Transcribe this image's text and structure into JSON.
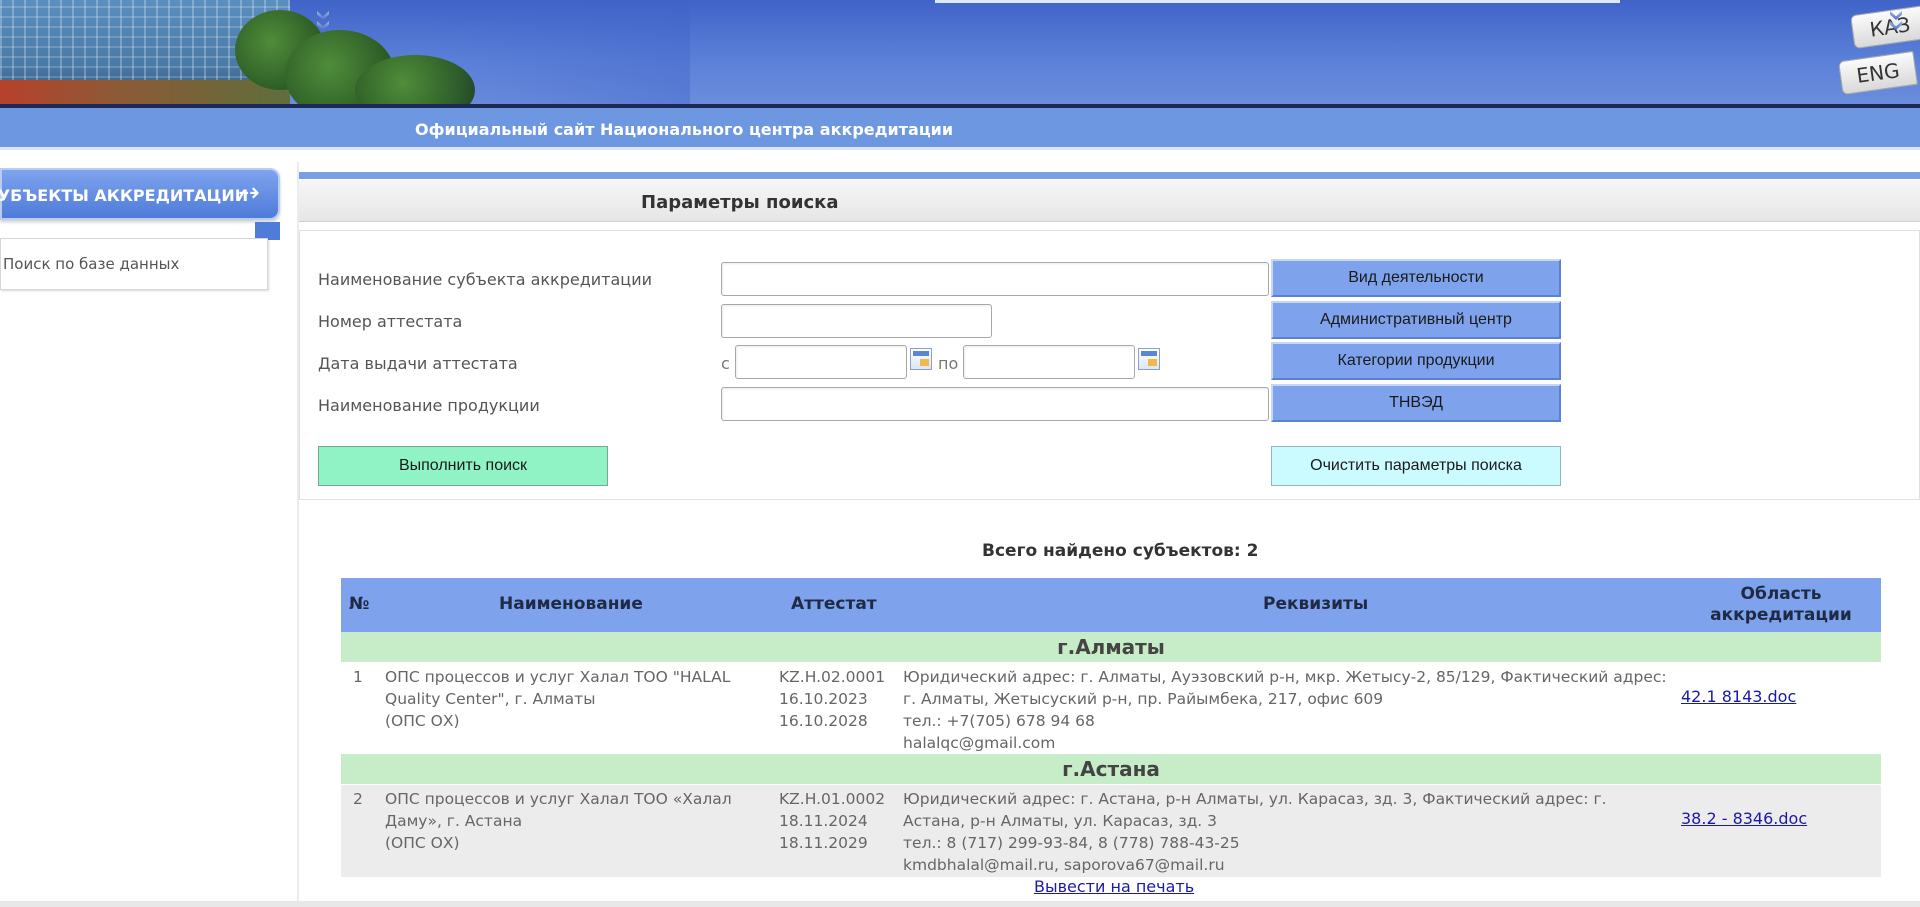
{
  "header": {
    "lang_kaz": "КАЗ",
    "lang_eng": "ENG",
    "site_title": "Официальный сайт Национального центра аккредитации"
  },
  "sidebar": {
    "section_title": "СУБЪЕКТЫ АККРЕДИТАЦИИ",
    "items": [
      {
        "label": "Поиск по базе данных"
      }
    ]
  },
  "search": {
    "panel_title": "Параметры поиска",
    "fields": {
      "subject_name": {
        "label": "Наименование субъекта аккредитации",
        "value": ""
      },
      "certificate_number": {
        "label": "Номер аттестата",
        "value": ""
      },
      "issue_date": {
        "label": "Дата выдачи аттестата",
        "from_label": "с",
        "to_label": "по",
        "from_value": "",
        "to_value": ""
      },
      "product_name": {
        "label": "Наименование продукции",
        "value": ""
      }
    },
    "side_buttons": {
      "activity_type": "Вид деятельности",
      "admin_center": "Административный центр",
      "product_categories": "Категории продукции",
      "tnved": "ТНВЭД"
    },
    "run_button": "Выполнить поиск",
    "clear_button": "Очистить параметры поиска"
  },
  "results": {
    "total_label": "Всего найдено субъектов: 2",
    "columns": {
      "num": "№",
      "name": "Наименование",
      "certificate": "Аттестат",
      "details": "Реквизиты",
      "scope_line1": "Область",
      "scope_line2": "аккредитации"
    },
    "groups": [
      {
        "city": "г.Алматы",
        "rows": [
          {
            "num": "1",
            "name_lines": [
              "ОПС процессов и услуг Халал ТОО \"HALAL",
              "Quality Center\", г. Алматы",
              "(ОПС ОХ)"
            ],
            "certificate_lines": [
              "KZ.H.02.0001",
              "16.10.2023",
              "16.10.2028"
            ],
            "detail_lines": [
              "Юридический адрес: г. Алматы, Ауэзовский р-н, мкр. Жетысу-2, 85/129, Фактический адрес:",
              "г. Алматы, Жетысуский р-н, пр. Райымбека, 217, офис 609",
              "тел.: +7(705) 678 94 68",
              "halalqc@gmail.com"
            ],
            "scope_doc": "42.1 8143.doc"
          }
        ]
      },
      {
        "city": "г.Астана",
        "rows": [
          {
            "num": "2",
            "name_lines": [
              "ОПС процессов и услуг Халал ТОО «Халал",
              "Даму», г. Астана",
              "(ОПС ОХ)"
            ],
            "certificate_lines": [
              "KZ.H.01.0002",
              "18.11.2024",
              "18.11.2029"
            ],
            "detail_lines": [
              "Юридический адрес: г. Астана, р-н Алматы, ул. Карасаз, зд. 3, Фактический адрес: г.",
              "Астана, р-н Алматы, ул. Карасаз, зд. 3",
              "тел.: 8 (717) 299-93-84, 8 (778) 788-43-25",
              "kmdbhalal@mail.ru, saporova67@mail.ru"
            ],
            "scope_doc": "38.2 - 8346.doc"
          }
        ]
      }
    ],
    "print_link": "Вывести на печать"
  }
}
